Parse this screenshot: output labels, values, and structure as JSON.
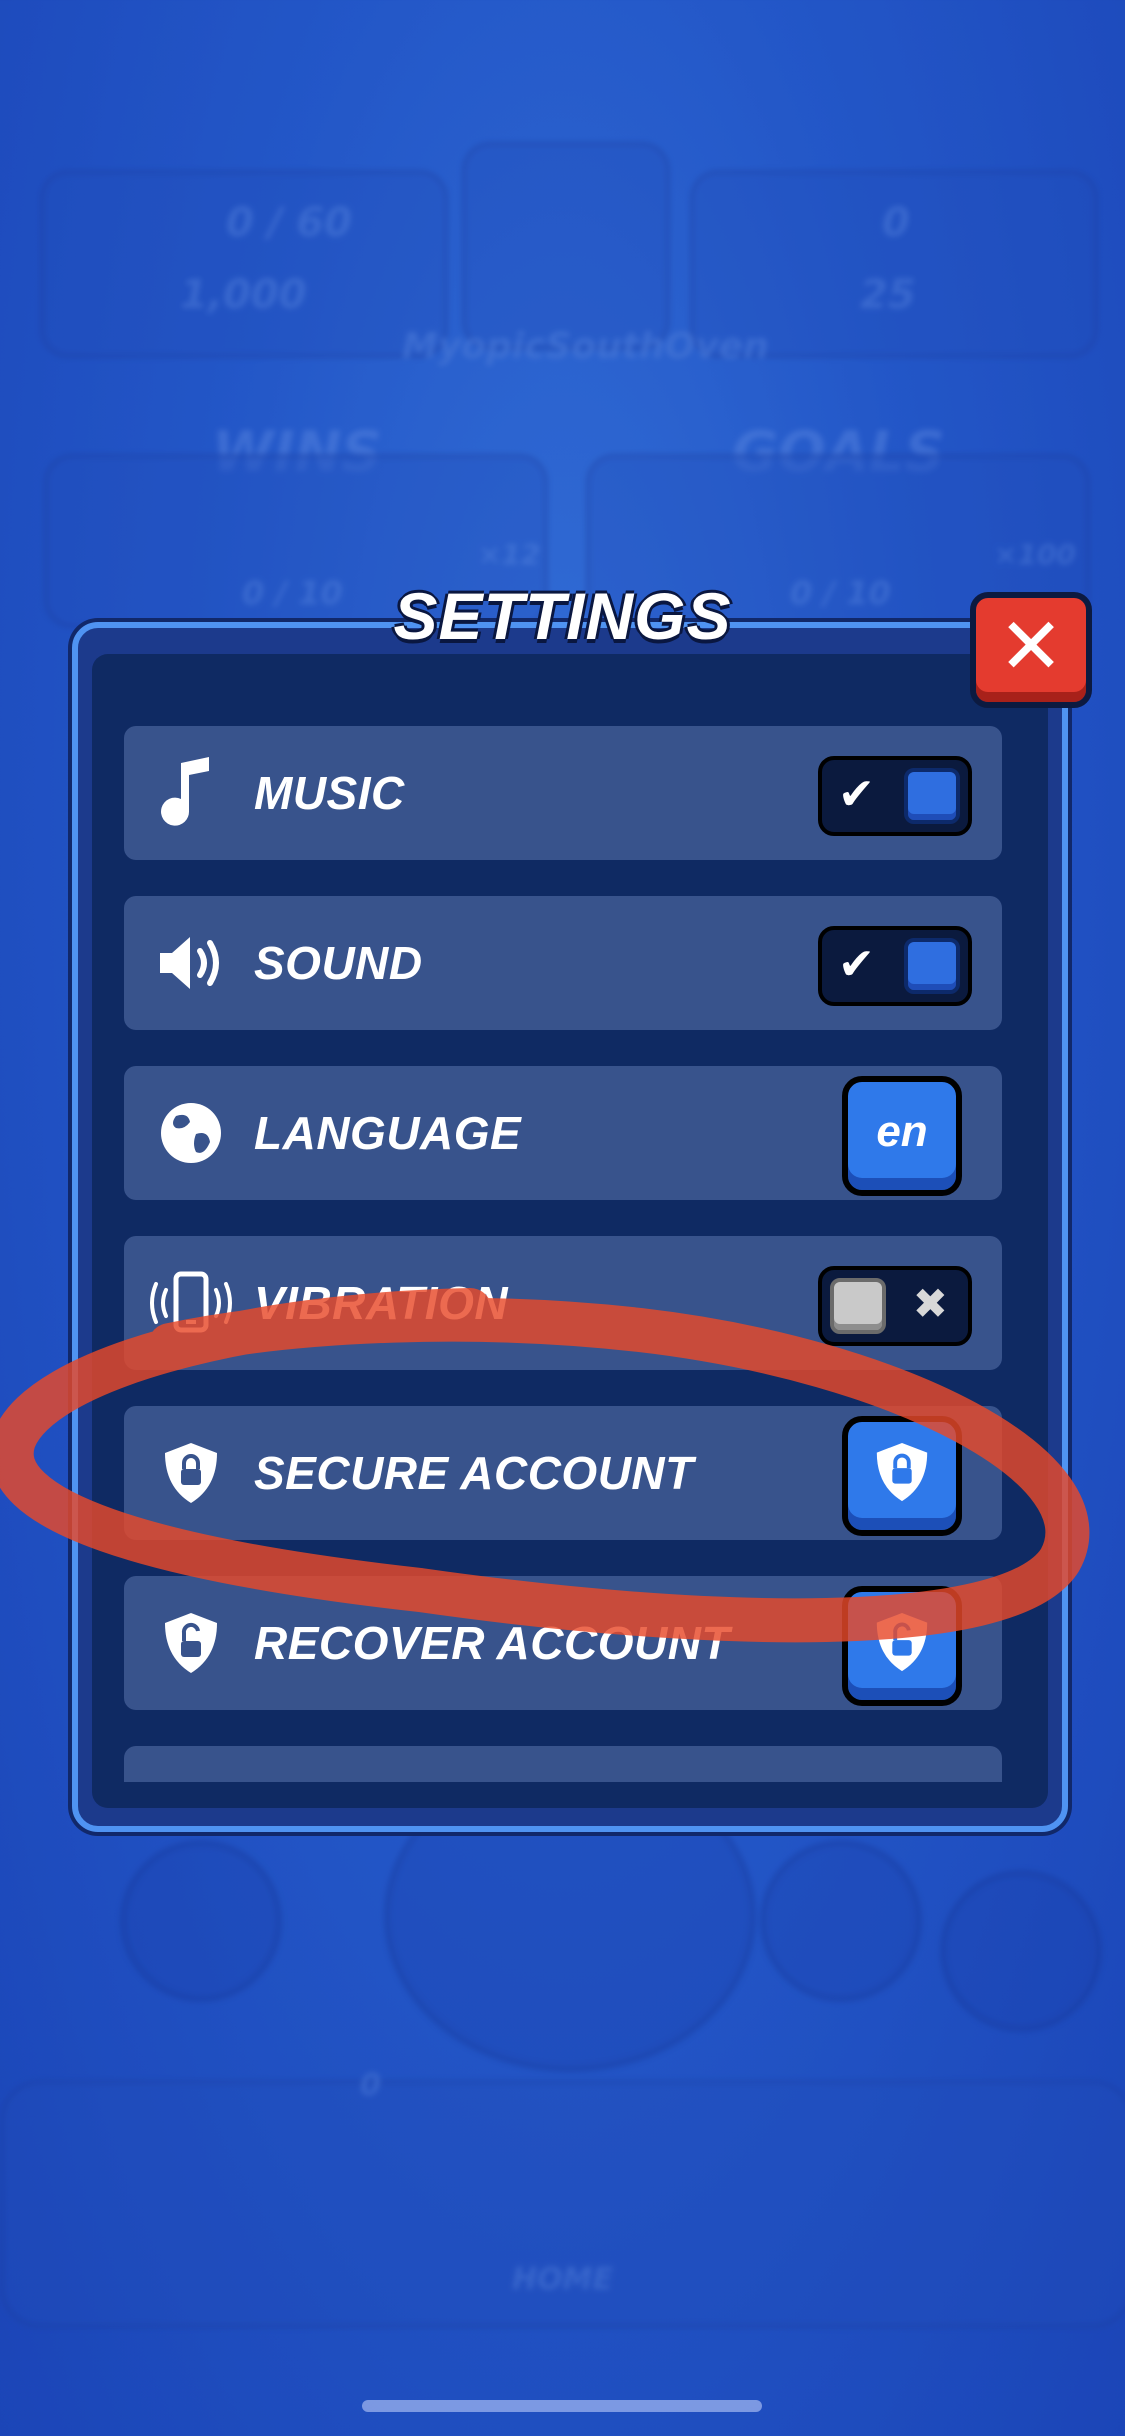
{
  "background": {
    "player_name": "MyopicSouthOven",
    "xp": "0 / 60",
    "coins": "1,000",
    "trophies": "0",
    "gems": "25",
    "wins_label": "WINS",
    "goals_label": "GOALS",
    "wins_progress": "0 / 10",
    "goals_progress": "0 / 10",
    "wins_reward": "×12",
    "goals_reward": "×100",
    "home_label": "HOME",
    "badge_count": "0"
  },
  "settings": {
    "title": "SETTINGS",
    "close_label": "✕",
    "rows": [
      {
        "label": "MUSIC",
        "icon": "music-note-icon",
        "control": "toggle",
        "on": true
      },
      {
        "label": "SOUND",
        "icon": "speaker-icon",
        "control": "toggle",
        "on": true
      },
      {
        "label": "LANGUAGE",
        "icon": "globe-icon",
        "control": "button",
        "value": "en"
      },
      {
        "label": "VIBRATION",
        "icon": "vibration-icon",
        "control": "toggle",
        "on": false
      },
      {
        "label": "SECURE ACCOUNT",
        "icon": "shield-lock-icon",
        "control": "button"
      },
      {
        "label": "RECOVER ACCOUNT",
        "icon": "shield-unlock-icon",
        "control": "button"
      }
    ]
  },
  "colors": {
    "panel": "#1c3a8c",
    "row": "#38538c",
    "accent": "#2f79ea",
    "close": "#e43b2f",
    "annotation": "#e8492a"
  }
}
